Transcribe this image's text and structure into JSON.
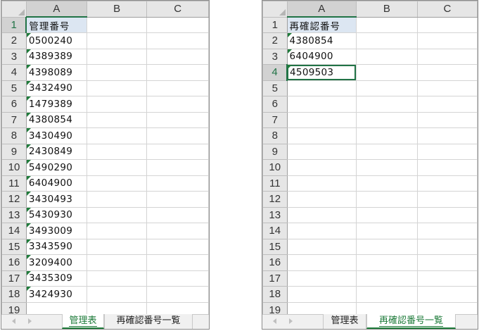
{
  "left_window": {
    "columns": [
      "A",
      "B",
      "C"
    ],
    "rows": [
      {
        "num": "1",
        "a": "管理番号"
      },
      {
        "num": "2",
        "a": "0500240"
      },
      {
        "num": "3",
        "a": "4389389"
      },
      {
        "num": "4",
        "a": "4398089"
      },
      {
        "num": "5",
        "a": "3432490"
      },
      {
        "num": "6",
        "a": "1479389"
      },
      {
        "num": "7",
        "a": "4380854"
      },
      {
        "num": "8",
        "a": "3430490"
      },
      {
        "num": "9",
        "a": "2430849"
      },
      {
        "num": "10",
        "a": "5490290"
      },
      {
        "num": "11",
        "a": "6404900"
      },
      {
        "num": "12",
        "a": "3430493"
      },
      {
        "num": "13",
        "a": "5430930"
      },
      {
        "num": "14",
        "a": "3493009"
      },
      {
        "num": "15",
        "a": "3343590"
      },
      {
        "num": "16",
        "a": "3209400"
      },
      {
        "num": "17",
        "a": "3435309"
      },
      {
        "num": "18",
        "a": "3424930"
      },
      {
        "num": "19",
        "a": ""
      }
    ],
    "tabs": [
      "管理表",
      "再確認番号一覧"
    ],
    "active_tab": "管理表"
  },
  "right_window": {
    "columns": [
      "A",
      "B",
      "C"
    ],
    "rows": [
      {
        "num": "1",
        "a": "再確認番号"
      },
      {
        "num": "2",
        "a": "4380854"
      },
      {
        "num": "3",
        "a": "6404900"
      },
      {
        "num": "4",
        "a": "4509503"
      },
      {
        "num": "5",
        "a": ""
      },
      {
        "num": "6",
        "a": ""
      },
      {
        "num": "7",
        "a": ""
      },
      {
        "num": "8",
        "a": ""
      },
      {
        "num": "9",
        "a": ""
      },
      {
        "num": "10",
        "a": ""
      },
      {
        "num": "11",
        "a": ""
      },
      {
        "num": "12",
        "a": ""
      },
      {
        "num": "13",
        "a": ""
      },
      {
        "num": "14",
        "a": ""
      },
      {
        "num": "15",
        "a": ""
      },
      {
        "num": "16",
        "a": ""
      },
      {
        "num": "17",
        "a": ""
      },
      {
        "num": "18",
        "a": ""
      },
      {
        "num": "19",
        "a": ""
      }
    ],
    "tabs": [
      "管理表",
      "再確認番号一覧"
    ],
    "active_tab": "再確認番号一覧"
  },
  "colors": {
    "excel_green": "#217346",
    "header_fill": "#dce6f2",
    "error_flag": "#1e7b3a"
  }
}
